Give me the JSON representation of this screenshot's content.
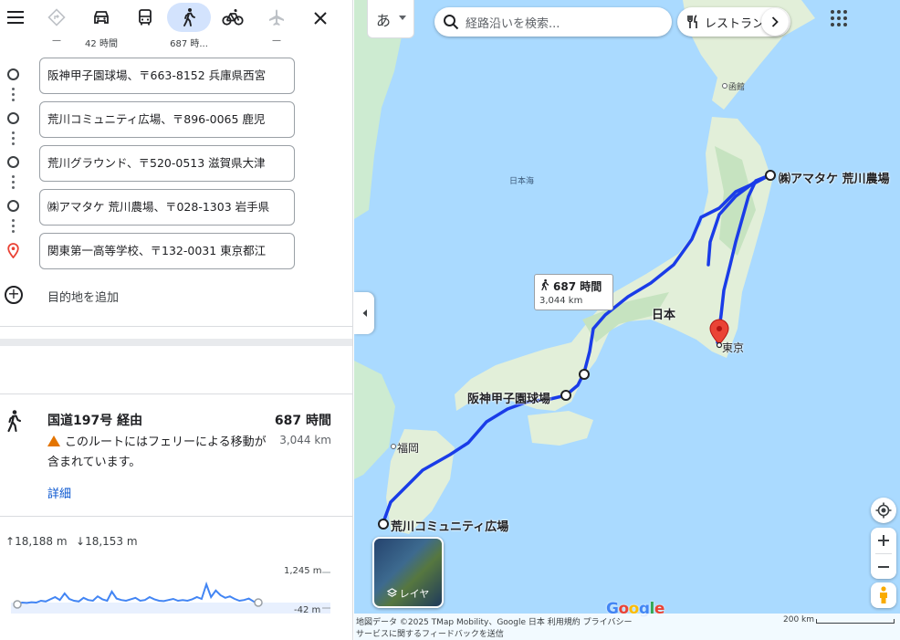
{
  "colors": {
    "accent": "#0b57d0",
    "route": "#1a3ce8",
    "warning": "#e37400",
    "pin": "#ea4335",
    "active_mode": "#d3e3fd"
  },
  "modes": [
    {
      "name": "best-route",
      "icon": "diamond-arrow-icon",
      "duration": "—",
      "enabled": false
    },
    {
      "name": "car",
      "icon": "car-icon",
      "duration": "42 時間",
      "enabled": true
    },
    {
      "name": "transit",
      "icon": "bus-icon",
      "duration": "",
      "enabled": true
    },
    {
      "name": "walk",
      "icon": "walk-icon",
      "duration": "687 時...",
      "enabled": true,
      "active": true
    },
    {
      "name": "bicycle",
      "icon": "bicycle-icon",
      "duration": "",
      "enabled": true
    },
    {
      "name": "flight",
      "icon": "plane-icon",
      "duration": "—",
      "enabled": false
    }
  ],
  "stops": [
    "阪神甲子園球場、〒663-8152 兵庫県西宮",
    "荒川コミュニティ広場、〒896-0065 鹿児",
    "荒川グラウンド、〒520-0513 滋賀県大津",
    "㈱アマタケ 荒川農場、〒028-1303 岩手県",
    "関東第一高等学校、〒132-0031 東京都江"
  ],
  "add_destination": "目的地を追加",
  "route": {
    "via": "国道197号 経由",
    "time": "687 時間",
    "distance": "3,044 km",
    "warning": "このルートにはフェリーによる移動が含まれています。",
    "details": "詳細"
  },
  "elevation": {
    "up": "18,188 m",
    "down": "18,153 m",
    "max_label": "1,245 m",
    "min_label": "-42 m",
    "profile": [
      0.02,
      0.05,
      0.04,
      0.06,
      0.05,
      0.1,
      0.08,
      0.14,
      0.2,
      0.12,
      0.3,
      0.15,
      0.1,
      0.08,
      0.18,
      0.12,
      0.1,
      0.22,
      0.14,
      0.1,
      0.35,
      0.16,
      0.12,
      0.1,
      0.14,
      0.18,
      0.1,
      0.12,
      0.2,
      0.14,
      0.1,
      0.09,
      0.12,
      0.15,
      0.1,
      0.12,
      0.1,
      0.14,
      0.2,
      0.15,
      0.55,
      0.2,
      0.38,
      0.25,
      0.18,
      0.22,
      0.15,
      0.1,
      0.12,
      0.16,
      0.08,
      0.02
    ]
  },
  "map": {
    "ime": "あ",
    "search_placeholder": "経路沿いを検索...",
    "chip": "レストラン",
    "labels": {
      "hakodate": "函館",
      "sea": "日本海",
      "japan": "日本",
      "tokyo": "東京",
      "fukuoka": "福岡",
      "amatake": "㈱アマタケ 荒川農場",
      "koshien": "阪神甲子園球場",
      "arakawa": "荒川コミュニティ広場"
    },
    "callout": {
      "time": "687 時間",
      "distance": "3,044 km"
    },
    "layer": "レイヤ",
    "google": "Google",
    "footer_line1": "地図データ ©2025 TMap Mobility、Google     日本     利用規約     プライバシー",
    "footer_line2": "サービスに関するフィードバックを送信",
    "scale": "200 km"
  }
}
